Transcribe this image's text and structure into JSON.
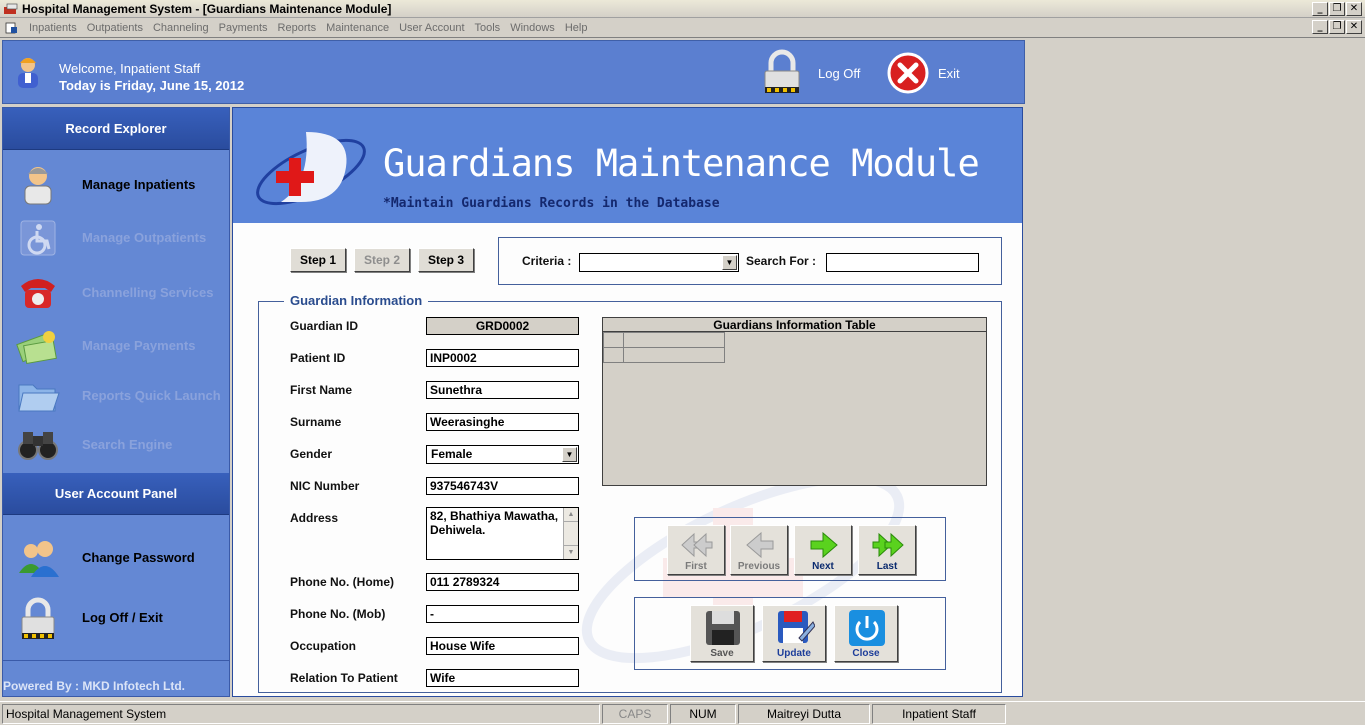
{
  "window": {
    "title": "Hospital Management System - [Guardians Maintenance Module]"
  },
  "menu": [
    "Inpatients",
    "Outpatients",
    "Channeling",
    "Payments",
    "Reports",
    "Maintenance",
    "User Account",
    "Tools",
    "Windows",
    "Help"
  ],
  "header": {
    "welcome": "Welcome, Inpatient Staff",
    "date": "Today is Friday, June 15, 2012",
    "logoff_label": "Log Off",
    "exit_label": "Exit"
  },
  "sidebar": {
    "record_explorer_title": "Record Explorer",
    "items": [
      {
        "label": "Manage Inpatients",
        "icon": "nurse-icon",
        "enabled": true
      },
      {
        "label": "Manage Outpatients",
        "icon": "wheelchair-icon",
        "enabled": false
      },
      {
        "label": "Channelling Services",
        "icon": "telephone-icon",
        "enabled": false
      },
      {
        "label": "Manage Payments",
        "icon": "money-icon",
        "enabled": false
      },
      {
        "label": "Reports Quick Launch",
        "icon": "folder-icon",
        "enabled": false
      },
      {
        "label": "Search Engine",
        "icon": "binoculars-icon",
        "enabled": false
      }
    ],
    "user_panel_title": "User Account Panel",
    "user_items": [
      {
        "label": "Change Password",
        "icon": "users-icon"
      },
      {
        "label": "Log Off / Exit",
        "icon": "lock-icon"
      }
    ],
    "powered_by": "Powered By :  MKD Infotech Ltd."
  },
  "banner": {
    "title": "Guardians Maintenance Module",
    "subtitle": "*Maintain Guardians Records in the Database"
  },
  "steps": {
    "step1": "Step 1",
    "step2": "Step 2",
    "step3": "Step 3"
  },
  "search": {
    "criteria_label": "Criteria :",
    "criteria_value": "",
    "search_for_label": "Search For :",
    "search_for_value": ""
  },
  "form": {
    "legend": "Guardian Information",
    "guardian_id_label": "Guardian ID",
    "guardian_id": "GRD0002",
    "patient_id_label": "Patient ID",
    "patient_id": "INP0002",
    "first_name_label": "First Name",
    "first_name": "Sunethra",
    "surname_label": "Surname",
    "surname": "Weerasinghe",
    "gender_label": "Gender",
    "gender": "Female",
    "nic_label": "NIC Number",
    "nic": "937546743V",
    "address_label": "Address",
    "address_line1": "82, Bhathiya Mawatha,",
    "address_line2": "Dehiwela.",
    "phone_home_label": "Phone No. (Home)",
    "phone_home": "011 2789324",
    "phone_mob_label": "Phone No. (Mob)",
    "phone_mob": "-",
    "occupation_label": "Occupation",
    "occupation": "House Wife",
    "relation_label": "Relation To Patient",
    "relation": "Wife"
  },
  "table": {
    "title": "Guardians Information Table"
  },
  "nav": {
    "first": "First",
    "previous": "Previous",
    "next": "Next",
    "last": "Last"
  },
  "actions": {
    "save": "Save",
    "update": "Update",
    "close": "Close"
  },
  "status": {
    "app": "Hospital Management System",
    "caps": "CAPS",
    "num": "NUM",
    "user": "Maitreyi Dutta",
    "role": "Inpatient Staff"
  }
}
